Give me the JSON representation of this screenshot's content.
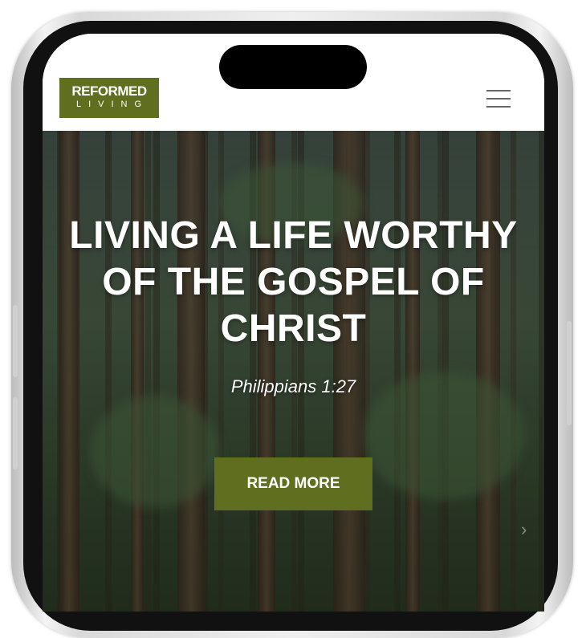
{
  "header": {
    "logo_top": "REFORMED",
    "logo_bottom": "LIVING"
  },
  "hero": {
    "title": "LIVING A LIFE WORTHY OF THE GOSPEL OF CHRIST",
    "reference": "Philippians 1:27",
    "button_label": "READ MORE",
    "next_glyph": "›"
  },
  "colors": {
    "brand_green": "#5f6f1f",
    "menu_icon": "#666666"
  },
  "icons": [
    "hamburger-menu-icon",
    "chevron-right-icon"
  ]
}
